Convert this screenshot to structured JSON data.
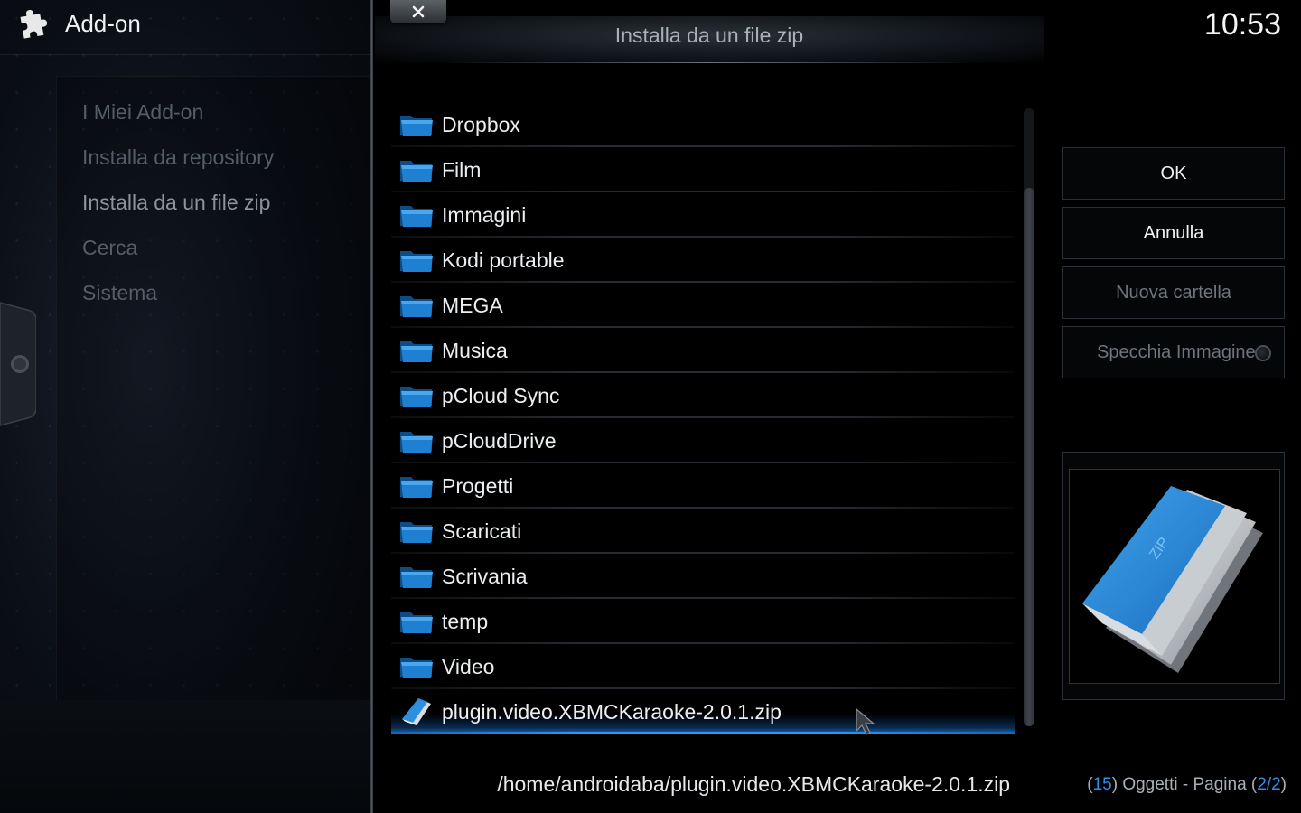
{
  "header": {
    "title": "Add-on",
    "icon": "puzzle-icon"
  },
  "menu": {
    "items": [
      {
        "label": "I Miei Add-on"
      },
      {
        "label": "Installa da repository"
      },
      {
        "label": "Installa da un file zip"
      },
      {
        "label": "Cerca"
      },
      {
        "label": "Sistema"
      }
    ]
  },
  "dialog": {
    "title": "Installa da un file zip",
    "close_icon": "close-icon",
    "items": [
      {
        "label": "Dropbox",
        "type": "folder"
      },
      {
        "label": "Film",
        "type": "folder"
      },
      {
        "label": "Immagini",
        "type": "folder"
      },
      {
        "label": "Kodi portable",
        "type": "folder"
      },
      {
        "label": "MEGA",
        "type": "folder"
      },
      {
        "label": "Musica",
        "type": "folder"
      },
      {
        "label": "pCloud Sync",
        "type": "folder"
      },
      {
        "label": "pCloudDrive",
        "type": "folder"
      },
      {
        "label": "Progetti",
        "type": "folder"
      },
      {
        "label": "Scaricati",
        "type": "folder"
      },
      {
        "label": "Scrivania",
        "type": "folder"
      },
      {
        "label": "temp",
        "type": "folder"
      },
      {
        "label": "Video",
        "type": "folder"
      },
      {
        "label": "plugin.video.XBMCKaraoke-2.0.1.zip",
        "type": "zip",
        "selected": true
      }
    ],
    "path": "/home/androidaba/plugin.video.XBMCKaraoke-2.0.1.zip"
  },
  "right": {
    "clock": "10:53",
    "buttons": {
      "ok": "OK",
      "cancel": "Annulla",
      "new_folder": "Nuova cartella",
      "mirror": "Specchia Immagine"
    },
    "count": {
      "open": "(",
      "items": "15",
      "middle": ") Oggetti - Pagina (",
      "page": "2/2",
      "close": ")"
    }
  },
  "colors": {
    "accent": "#2f8fe6",
    "folder": "#1f7fd0"
  }
}
